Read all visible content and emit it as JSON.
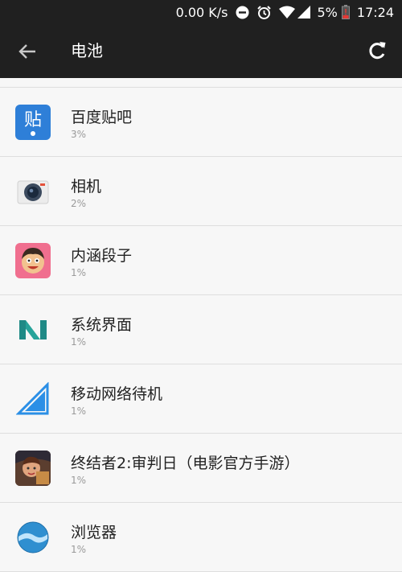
{
  "status_bar": {
    "net_speed": "0.00 K/s",
    "battery_percent": "5%",
    "time": "17:24",
    "icons": [
      "do-not-disturb-icon",
      "alarm-icon",
      "wifi-icon",
      "signal-icon",
      "battery-icon"
    ]
  },
  "app_bar": {
    "title": "电池",
    "back_icon": "arrow-left-icon",
    "refresh_icon": "refresh-icon"
  },
  "apps": [
    {
      "name": "百度贴吧",
      "usage": "3%",
      "icon": "baidu-tieba-icon",
      "icon_text": "贴"
    },
    {
      "name": "相机",
      "usage": "2%",
      "icon": "camera-icon"
    },
    {
      "name": "内涵段子",
      "usage": "1%",
      "icon": "neihan-duanzi-icon"
    },
    {
      "name": "系统界面",
      "usage": "1%",
      "icon": "system-ui-icon"
    },
    {
      "name": "移动网络待机",
      "usage": "1%",
      "icon": "cell-standby-icon"
    },
    {
      "name": "终结者2:审判日（电影官方手游）",
      "usage": "1%",
      "icon": "terminator2-game-icon"
    },
    {
      "name": "浏览器",
      "usage": "1%",
      "icon": "browser-icon"
    }
  ],
  "colors": {
    "bar_bg": "#202020",
    "list_bg": "#f7f7f7",
    "tieba_blue": "#2e7fd8",
    "system_teal": "#1f8a86",
    "signal_blue": "#2b8fe6",
    "battery_red": "#e53935"
  }
}
